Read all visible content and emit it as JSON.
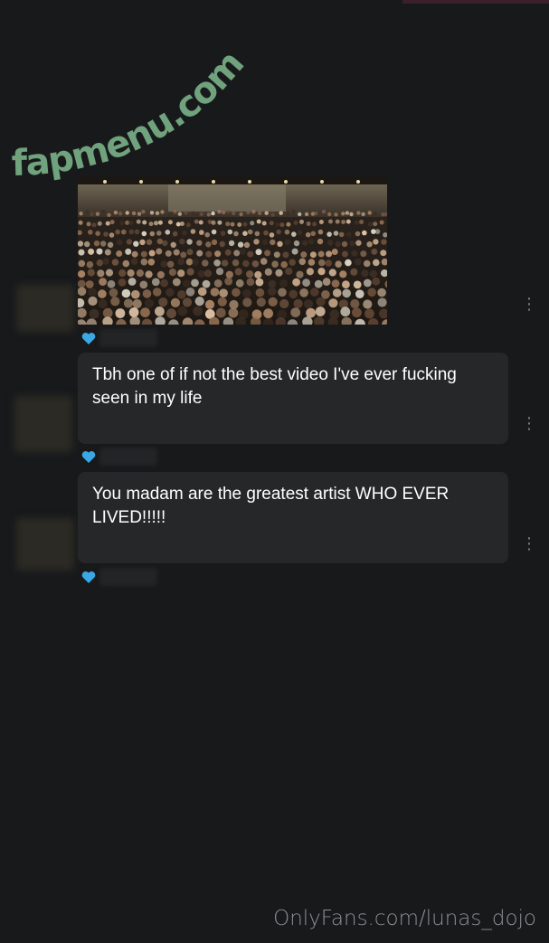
{
  "watermark": {
    "text": "fapmenu.com",
    "color": "#6fa27d"
  },
  "messages": [
    {
      "media": {
        "description_icon": "image-icon"
      },
      "liked": true
    },
    {
      "text": "Tbh one of if not the best video I've ever fucking seen in my life",
      "liked": true
    },
    {
      "text": "You madam are the greatest artist WHO EVER LIVED!!!!!",
      "liked": true
    }
  ],
  "footer": {
    "text": "OnlyFans.com/lunas_dojo"
  },
  "colors": {
    "background": "#18191b",
    "bubble": "#262729",
    "heart": "#3ba8e6",
    "menu_dots": "#7d7f83"
  },
  "icons": {
    "like": "heart-icon",
    "menu": "more-vertical-icon"
  }
}
